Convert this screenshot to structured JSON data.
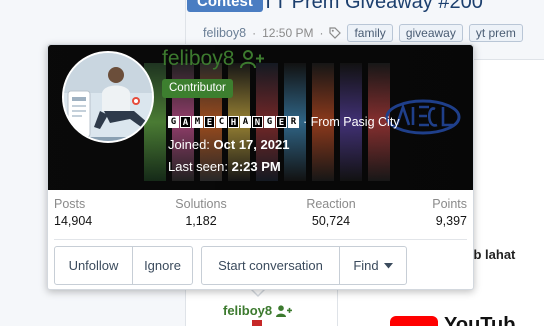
{
  "background": {
    "prefix_badge": "Contest",
    "thread_title": "TT Prem Giveaway #200",
    "meta": {
      "author": "feliboy8",
      "time": "12:50 PM",
      "tags": [
        "family",
        "giveaway",
        "yt prem"
      ]
    },
    "side_item_text": "n nb lahat",
    "yt_text": "YouTub",
    "poster_name": "feliboy8"
  },
  "popup": {
    "username": "feliboy8",
    "user_title": "Contributor",
    "signature_letters": [
      "G",
      "A",
      "M",
      "E",
      "C",
      "H",
      "A",
      "N",
      "G",
      "E",
      "R"
    ],
    "location": "· From Pasig City",
    "joined_label": "Joined:",
    "joined_value": "Oct 17, 2021",
    "last_seen_label": "Last seen:",
    "last_seen_value": "2:23 PM",
    "stats": [
      {
        "label": "Posts",
        "value": "14,904"
      },
      {
        "label": "Solutions",
        "value": "1,182"
      },
      {
        "label": "Reaction",
        "value": "50,724"
      },
      {
        "label": "Points",
        "value": "9,397"
      }
    ],
    "buttons": {
      "unfollow": "Unfollow",
      "ignore": "Ignore",
      "start_conversation": "Start conversation",
      "find": "Find"
    }
  },
  "colors": {
    "accent_green": "#3c7a2e",
    "prefix_blue": "#4a7dc2",
    "text_muted": "#8a8a8a"
  },
  "icons": {
    "follow": "user-plus-icon",
    "tag": "tag-icon",
    "dropdown": "caret-down-icon"
  }
}
